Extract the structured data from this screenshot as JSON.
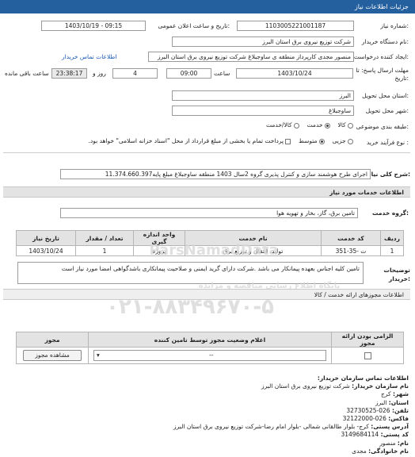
{
  "header": {
    "title": "جزئیات اطلاعات نیاز"
  },
  "form": {
    "need_number": {
      "label": "شماره نیاز:",
      "value": "1103005221001187"
    },
    "announce_date": {
      "label": "تاریخ و ساعت اعلان عمومی:",
      "value": "1403/10/19 - 09:15"
    },
    "buyer_org": {
      "label": "نام دستگاه خریدار:",
      "value": "شرکت توزیع نیروی برق استان البرز"
    },
    "requester": {
      "label": "ایجاد کننده درخواست:",
      "value": "منصور مجدی کارپرداز منطقه ی ساوجبلاغ شرکت توزیع نیروی برق استان البرز",
      "contact_link": "اطلاعات تماس خریدار"
    },
    "deadline": {
      "label": "مهلت ارسال پاسخ: تا تاریخ:",
      "date": "1403/10/24",
      "time_label": "ساعت",
      "time": "09:00",
      "days": "4",
      "days_label": "روز و",
      "remaining": "23:38:17",
      "remaining_label": "ساعت باقی مانده"
    },
    "province": {
      "label": "استان محل تحویل:",
      "value": "البرز"
    },
    "city": {
      "label": "شهر محل تحویل:",
      "value": "ساوجبلاغ"
    },
    "category": {
      "label": "طبقه بندی موضوعی:",
      "options": [
        "کالا",
        "خدمت",
        "کالا/خدمت"
      ],
      "selected": "خدمت"
    },
    "process": {
      "label": "نوع فرآیند خرید :",
      "options": [
        "جزیی",
        "متوسط"
      ],
      "selected": "متوسط",
      "note": "پرداخت تمام یا بخشی از مبلغ قرارداد از محل \"اسناد خزانه اسلامی\" خواهد بود."
    }
  },
  "summary": {
    "label": "شرح کلی نیاز:",
    "value": "اجرای طرح هوشمند سازی و کنترل پذیری گروه 2سال 1403 منطقه ساوجبلاغ مبلغ پایه11.374.660.397"
  },
  "services": {
    "title": "اطلاعات خدمات مورد نیاز",
    "group_label": "گروه خدمت:",
    "group_value": "تامین برق، گاز، بخار و تهویه هوا",
    "columns": [
      "ردیف",
      "کد خدمت",
      "نام خدمت",
      "واحد اندازه گیری",
      "تعداد / مقدار",
      "تاریخ نیاز"
    ],
    "rows": [
      [
        "1",
        "ت -35-351",
        "تولید، انتقال و توزیع برق",
        "پروژه",
        "1",
        "1403/10/24"
      ]
    ]
  },
  "buyer_notes": {
    "label": "توضیحات خریدار:",
    "value": "تامین کلیه اجناس بعهده پیمانکار می باشد .شرکت دارای گرید ایمنی و صلاحیت پیمانکاری باشدگواهی امضا مورد نیاز است"
  },
  "permits": {
    "title": "اطلاعات مجوزهای ارائه خدمت / کالا",
    "columns": [
      "الزامی بودن ارائه مجوز",
      "اعلام وضعیت مجوز توسط تامین کننده",
      "مجوز"
    ],
    "row": {
      "status": "--",
      "view_button": "مشاهده مجوز"
    }
  },
  "contact": {
    "title": "اطلاعات تماس سازمان خریدار:",
    "lines": [
      {
        "label": "نام سازمان خریدار:",
        "value": "شرکت توزیع نیروی برق استان البرز"
      },
      {
        "label": "شهر:",
        "value": "کرج"
      },
      {
        "label": "استان:",
        "value": "البرز"
      },
      {
        "label": "تلفن:",
        "value": "026-32730525"
      },
      {
        "label": "فاکس:",
        "value": "026-32122000"
      },
      {
        "label": "آدرس پستی:",
        "value": "کرج- بلوار طالقانی شمالی -بلوار امام رضا-شرکت توزیع نیروی برق استان البرز"
      },
      {
        "label": "کد پستی:",
        "value": "3149684114"
      },
      {
        "label": "نام:",
        "value": "منصور"
      },
      {
        "label": "نام خانوادگی:",
        "value": "مجدی"
      }
    ]
  },
  "watermark": {
    "line1": "پایگاه اطلاع رسانی مناقصه و مزایده",
    "line2": "ParsNamadData",
    "line3": "۰۲۱-۸۸۳۴۹۶۷۰-۵"
  },
  "colors": {
    "header": "#245f9e",
    "link": "#1a5bb5",
    "remaining_bg": "#e9e9e9"
  }
}
